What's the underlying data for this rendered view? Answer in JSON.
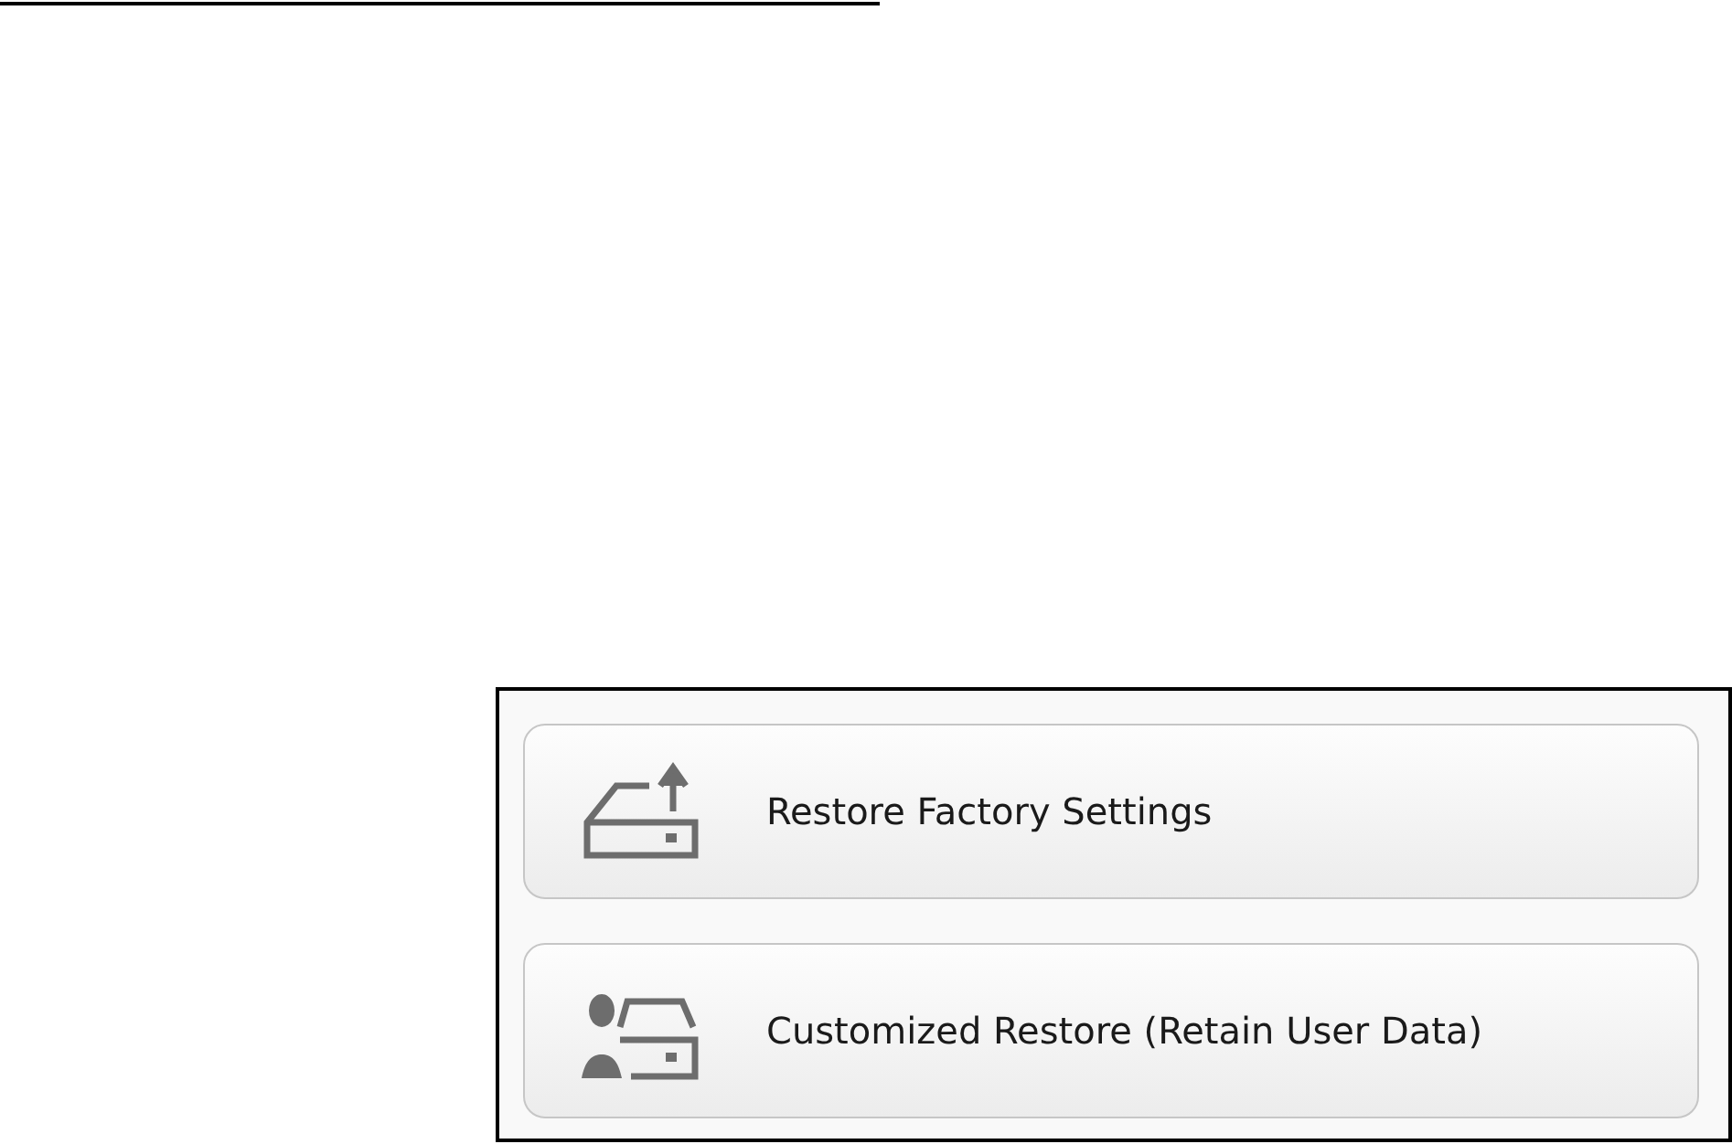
{
  "options": [
    {
      "label": "Restore Factory Settings",
      "kind": "factory"
    },
    {
      "label": "Customized Restore (Retain User Data)",
      "kind": "custom"
    }
  ]
}
